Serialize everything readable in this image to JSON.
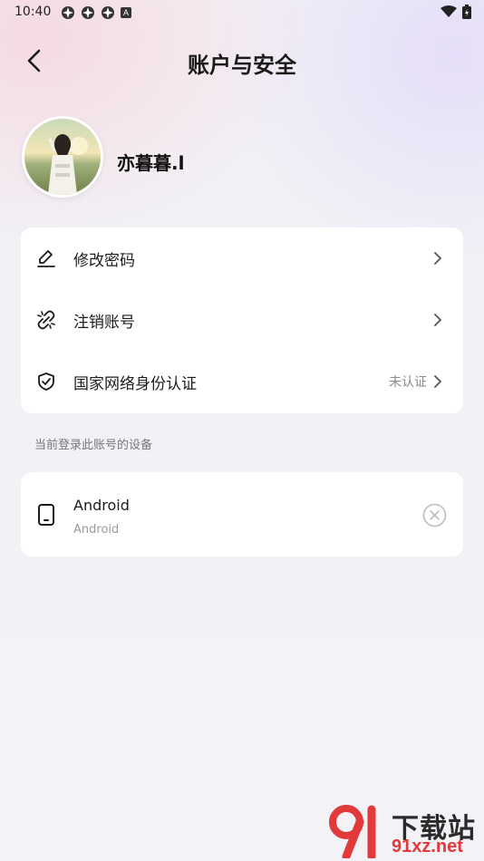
{
  "status_bar": {
    "time": "10:40",
    "icons_left": [
      "app-icon",
      "app-icon",
      "app-icon",
      "a-icon"
    ],
    "a_label": "A",
    "icons_right": [
      "wifi-icon",
      "battery-icon"
    ]
  },
  "header": {
    "title": "账户与安全",
    "back_icon": "chevron-left-icon"
  },
  "profile": {
    "username": "亦暮暮.l"
  },
  "menu": {
    "items": [
      {
        "label": "修改密码",
        "icon": "edit-icon",
        "status": ""
      },
      {
        "label": "注销账号",
        "icon": "unlink-icon",
        "status": ""
      },
      {
        "label": "国家网络身份认证",
        "icon": "shield-check-icon",
        "status": "未认证"
      }
    ]
  },
  "devices_section": {
    "label": "当前登录此账号的设备",
    "devices": [
      {
        "name": "Android",
        "subtitle": "Android",
        "icon": "phone-icon"
      }
    ]
  },
  "watermark": {
    "line1": "下载站",
    "line2": "91xz.net"
  },
  "colors": {
    "background": "#f2f2f7",
    "card": "#ffffff",
    "text_primary": "#1a1a1a",
    "text_secondary": "#8a8a8a",
    "watermark_red": "#e23a3a"
  }
}
